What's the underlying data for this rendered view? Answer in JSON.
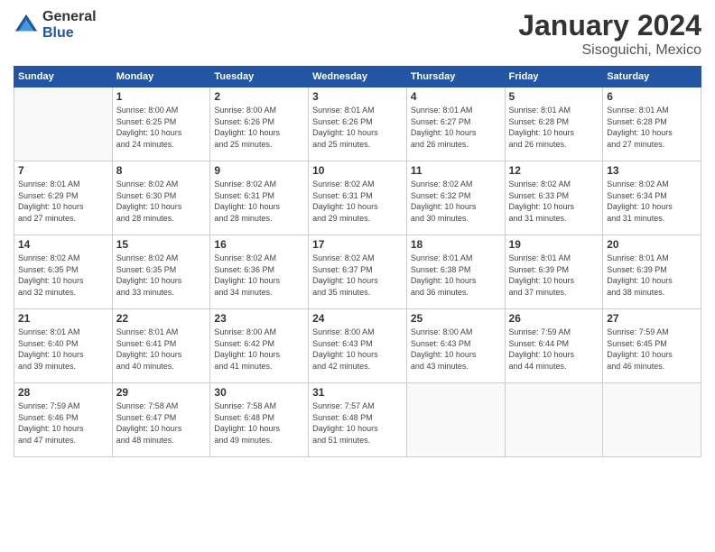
{
  "header": {
    "logo_general": "General",
    "logo_blue": "Blue",
    "month_title": "January 2024",
    "location": "Sisoguichi, Mexico"
  },
  "weekdays": [
    "Sunday",
    "Monday",
    "Tuesday",
    "Wednesday",
    "Thursday",
    "Friday",
    "Saturday"
  ],
  "weeks": [
    [
      {
        "day": "",
        "info": ""
      },
      {
        "day": "1",
        "info": "Sunrise: 8:00 AM\nSunset: 6:25 PM\nDaylight: 10 hours\nand 24 minutes."
      },
      {
        "day": "2",
        "info": "Sunrise: 8:00 AM\nSunset: 6:26 PM\nDaylight: 10 hours\nand 25 minutes."
      },
      {
        "day": "3",
        "info": "Sunrise: 8:01 AM\nSunset: 6:26 PM\nDaylight: 10 hours\nand 25 minutes."
      },
      {
        "day": "4",
        "info": "Sunrise: 8:01 AM\nSunset: 6:27 PM\nDaylight: 10 hours\nand 26 minutes."
      },
      {
        "day": "5",
        "info": "Sunrise: 8:01 AM\nSunset: 6:28 PM\nDaylight: 10 hours\nand 26 minutes."
      },
      {
        "day": "6",
        "info": "Sunrise: 8:01 AM\nSunset: 6:28 PM\nDaylight: 10 hours\nand 27 minutes."
      }
    ],
    [
      {
        "day": "7",
        "info": "Sunrise: 8:01 AM\nSunset: 6:29 PM\nDaylight: 10 hours\nand 27 minutes."
      },
      {
        "day": "8",
        "info": "Sunrise: 8:02 AM\nSunset: 6:30 PM\nDaylight: 10 hours\nand 28 minutes."
      },
      {
        "day": "9",
        "info": "Sunrise: 8:02 AM\nSunset: 6:31 PM\nDaylight: 10 hours\nand 28 minutes."
      },
      {
        "day": "10",
        "info": "Sunrise: 8:02 AM\nSunset: 6:31 PM\nDaylight: 10 hours\nand 29 minutes."
      },
      {
        "day": "11",
        "info": "Sunrise: 8:02 AM\nSunset: 6:32 PM\nDaylight: 10 hours\nand 30 minutes."
      },
      {
        "day": "12",
        "info": "Sunrise: 8:02 AM\nSunset: 6:33 PM\nDaylight: 10 hours\nand 31 minutes."
      },
      {
        "day": "13",
        "info": "Sunrise: 8:02 AM\nSunset: 6:34 PM\nDaylight: 10 hours\nand 31 minutes."
      }
    ],
    [
      {
        "day": "14",
        "info": "Sunrise: 8:02 AM\nSunset: 6:35 PM\nDaylight: 10 hours\nand 32 minutes."
      },
      {
        "day": "15",
        "info": "Sunrise: 8:02 AM\nSunset: 6:35 PM\nDaylight: 10 hours\nand 33 minutes."
      },
      {
        "day": "16",
        "info": "Sunrise: 8:02 AM\nSunset: 6:36 PM\nDaylight: 10 hours\nand 34 minutes."
      },
      {
        "day": "17",
        "info": "Sunrise: 8:02 AM\nSunset: 6:37 PM\nDaylight: 10 hours\nand 35 minutes."
      },
      {
        "day": "18",
        "info": "Sunrise: 8:01 AM\nSunset: 6:38 PM\nDaylight: 10 hours\nand 36 minutes."
      },
      {
        "day": "19",
        "info": "Sunrise: 8:01 AM\nSunset: 6:39 PM\nDaylight: 10 hours\nand 37 minutes."
      },
      {
        "day": "20",
        "info": "Sunrise: 8:01 AM\nSunset: 6:39 PM\nDaylight: 10 hours\nand 38 minutes."
      }
    ],
    [
      {
        "day": "21",
        "info": "Sunrise: 8:01 AM\nSunset: 6:40 PM\nDaylight: 10 hours\nand 39 minutes."
      },
      {
        "day": "22",
        "info": "Sunrise: 8:01 AM\nSunset: 6:41 PM\nDaylight: 10 hours\nand 40 minutes."
      },
      {
        "day": "23",
        "info": "Sunrise: 8:00 AM\nSunset: 6:42 PM\nDaylight: 10 hours\nand 41 minutes."
      },
      {
        "day": "24",
        "info": "Sunrise: 8:00 AM\nSunset: 6:43 PM\nDaylight: 10 hours\nand 42 minutes."
      },
      {
        "day": "25",
        "info": "Sunrise: 8:00 AM\nSunset: 6:43 PM\nDaylight: 10 hours\nand 43 minutes."
      },
      {
        "day": "26",
        "info": "Sunrise: 7:59 AM\nSunset: 6:44 PM\nDaylight: 10 hours\nand 44 minutes."
      },
      {
        "day": "27",
        "info": "Sunrise: 7:59 AM\nSunset: 6:45 PM\nDaylight: 10 hours\nand 46 minutes."
      }
    ],
    [
      {
        "day": "28",
        "info": "Sunrise: 7:59 AM\nSunset: 6:46 PM\nDaylight: 10 hours\nand 47 minutes."
      },
      {
        "day": "29",
        "info": "Sunrise: 7:58 AM\nSunset: 6:47 PM\nDaylight: 10 hours\nand 48 minutes."
      },
      {
        "day": "30",
        "info": "Sunrise: 7:58 AM\nSunset: 6:48 PM\nDaylight: 10 hours\nand 49 minutes."
      },
      {
        "day": "31",
        "info": "Sunrise: 7:57 AM\nSunset: 6:48 PM\nDaylight: 10 hours\nand 51 minutes."
      },
      {
        "day": "",
        "info": ""
      },
      {
        "day": "",
        "info": ""
      },
      {
        "day": "",
        "info": ""
      }
    ]
  ]
}
